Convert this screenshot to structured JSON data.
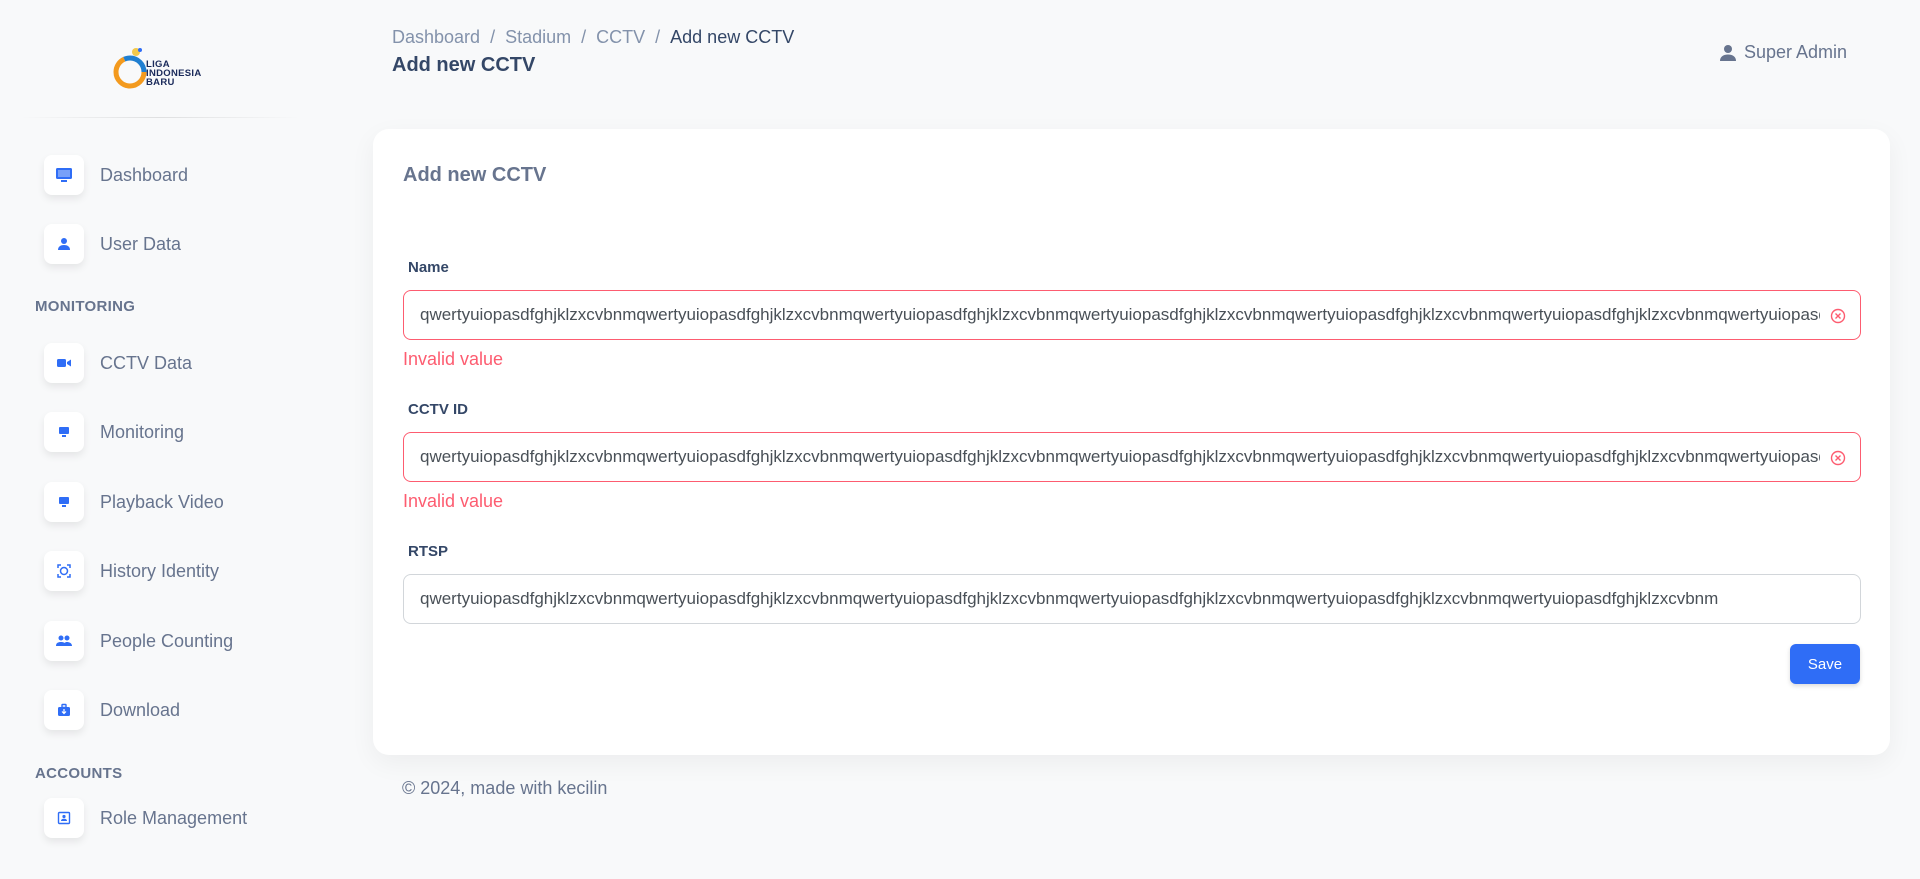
{
  "sidebar": {
    "logo_lines": [
      "LIGA",
      "INDONESIA",
      "BARU"
    ],
    "items": [
      {
        "label": "Dashboard"
      },
      {
        "label": "User Data"
      },
      {
        "label": "CCTV Data"
      },
      {
        "label": "Monitoring"
      },
      {
        "label": "Playback Video"
      },
      {
        "label": "History Identity"
      },
      {
        "label": "People Counting"
      },
      {
        "label": "Download"
      },
      {
        "label": "Role Management"
      }
    ],
    "sections": {
      "monitoring": "MONITORING",
      "accounts": "ACCOUNTS"
    }
  },
  "header": {
    "breadcrumb": [
      "Dashboard",
      "Stadium",
      "CCTV",
      "Add new CCTV"
    ],
    "separator": "/",
    "title": "Add new CCTV",
    "user": "Super Admin"
  },
  "form": {
    "title": "Add new CCTV",
    "name_label": "Name",
    "name_value": "qwertyuiopasdfghjklzxcvbnmqwertyuiopasdfghjklzxcvbnmqwertyuiopasdfghjklzxcvbnmqwertyuiopasdfghjklzxcvbnmqwertyuiopasdfghjklzxcvbnmqwertyuiopasdfghjklzxcvbnmqwertyuiopasdfghjklzxcvbnm",
    "name_error": "Invalid value",
    "cctv_id_label": "CCTV ID",
    "cctv_id_value": "qwertyuiopasdfghjklzxcvbnmqwertyuiopasdfghjklzxcvbnmqwertyuiopasdfghjklzxcvbnmqwertyuiopasdfghjklzxcvbnmqwertyuiopasdfghjklzxcvbnmqwertyuiopasdfghjklzxcvbnmqwertyuiopasdfghjklzxcvbnm",
    "cctv_id_error": "Invalid value",
    "rtsp_label": "RTSP",
    "rtsp_value": "qwertyuiopasdfghjklzxcvbnmqwertyuiopasdfghjklzxcvbnmqwertyuiopasdfghjklzxcvbnmqwertyuiopasdfghjklzxcvbnmqwertyuiopasdfghjklzxcvbnmqwertyuiopasdfghjklzxcvbnm",
    "save_label": "Save"
  },
  "footer": "© 2024, made with kecilin",
  "colors": {
    "accent": "#2f6df6",
    "error": "#fd5c70",
    "icon": "#2f6df6"
  }
}
